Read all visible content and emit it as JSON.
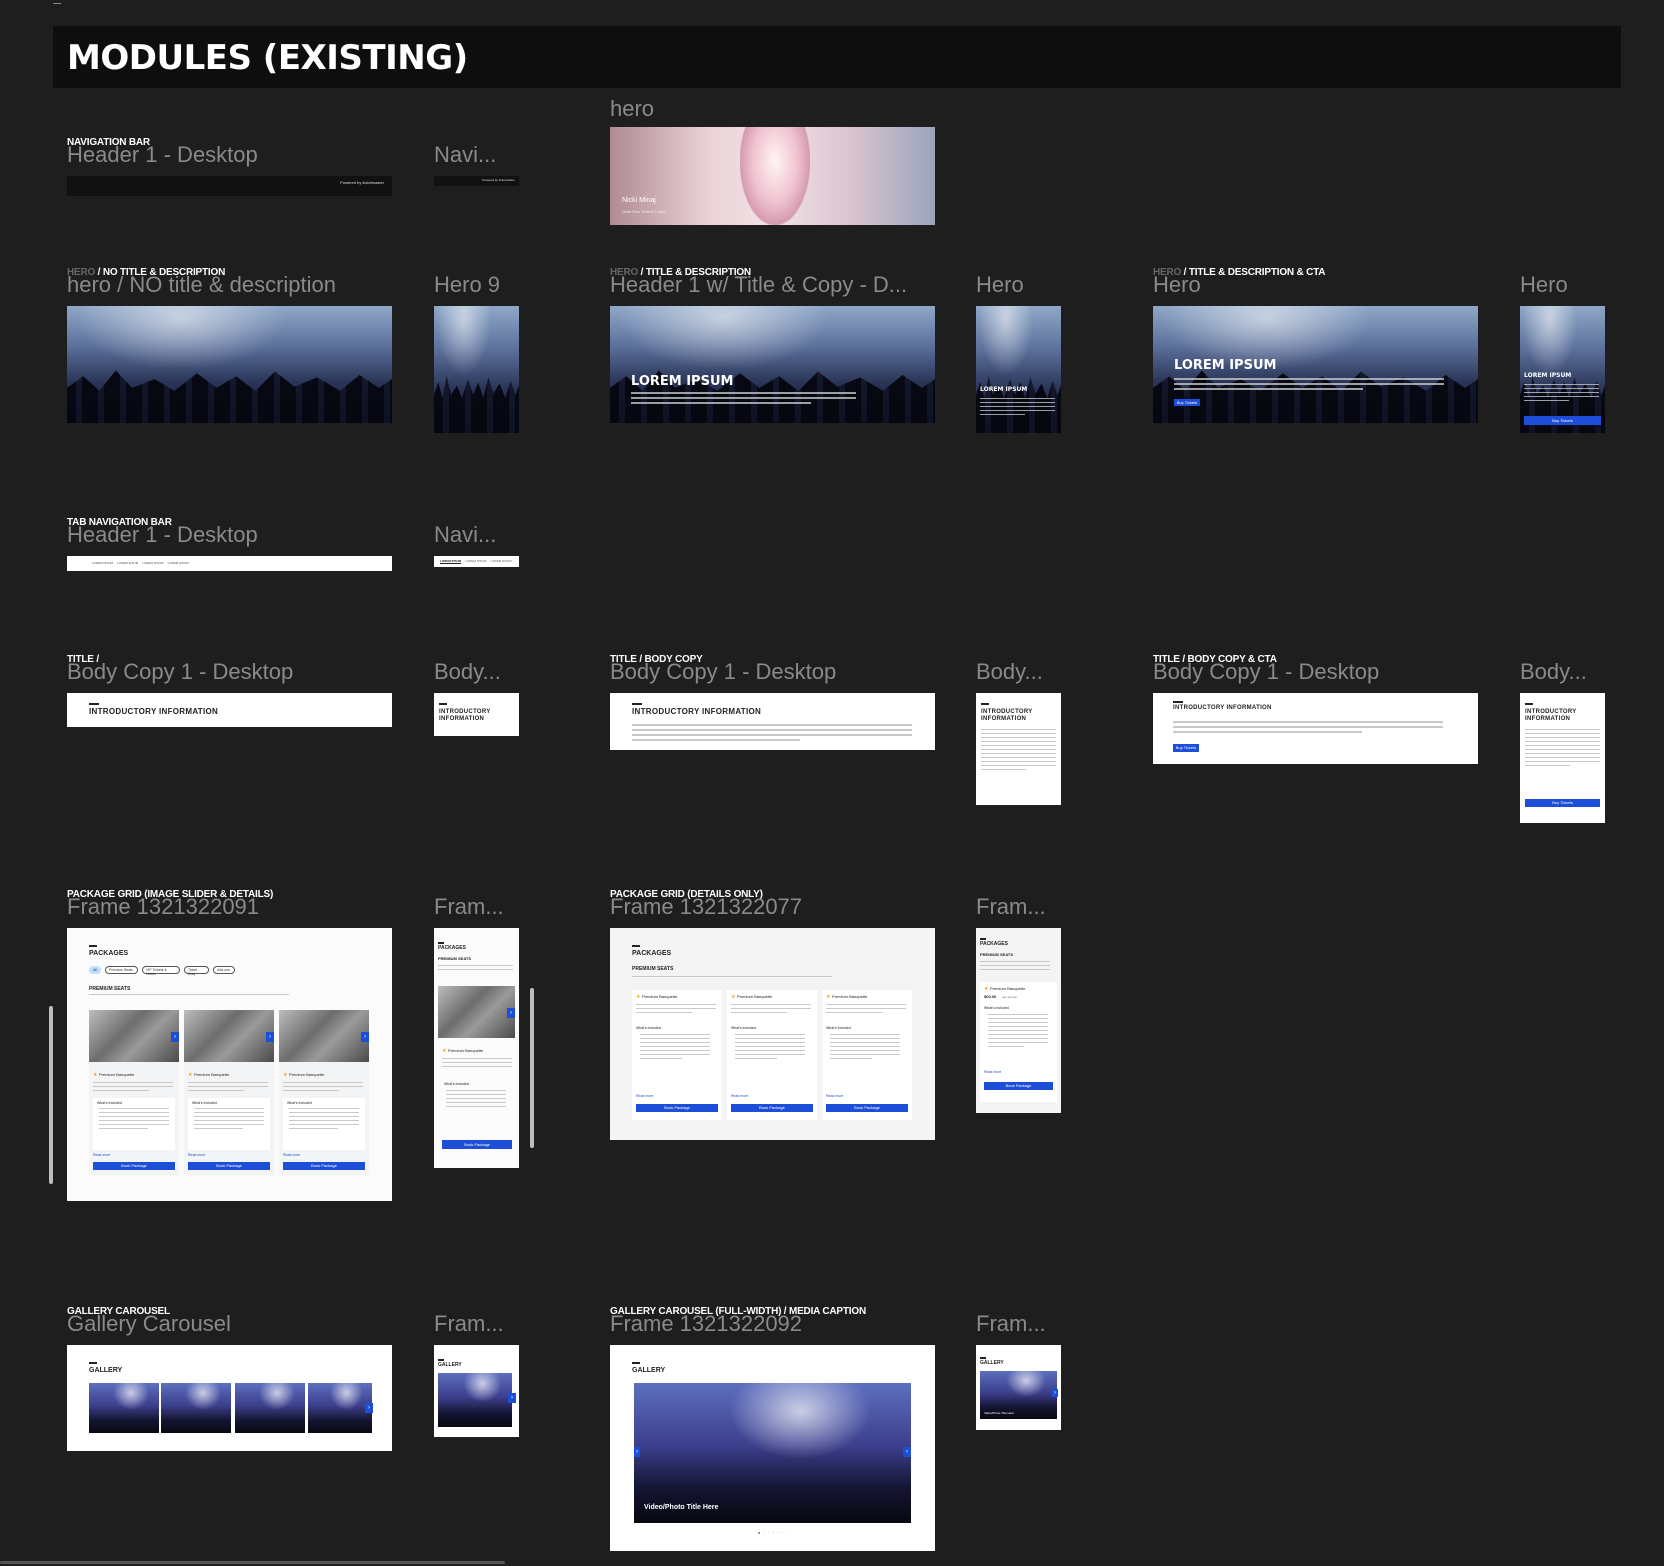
{
  "page_title": "MODULES (EXISTING)",
  "sections": {
    "navigation_bar": {
      "tag": "NAVIGATION BAR",
      "desktop_label": "Header 1 - Desktop",
      "mobile_label": "Navi...",
      "powered_by": "Powered by ticketmaster"
    },
    "hero_top": {
      "label": "hero",
      "artist": "Nicki Minaj",
      "artist_sub": "Grab Your Tickets Today"
    },
    "hero_no_title": {
      "tag_dim": "HERO",
      "tag": " / NO TITLE & DESCRIPTION",
      "desktop_label": "hero / NO title & description",
      "mobile_label": "Hero 9"
    },
    "hero_title_desc": {
      "tag_dim": "HERO",
      "tag": " / TITLE & DESCRIPTION",
      "desktop_label": "Header 1 w/ Title & Copy - D...",
      "mobile_label": "Hero",
      "title": "LOREM IPSUM"
    },
    "hero_title_desc_cta": {
      "tag_dim": "HERO",
      "tag": " / TITLE & DESCRIPTION & CTA",
      "desktop_label": "Hero",
      "mobile_label": "Hero",
      "title": "LOREM IPSUM",
      "cta": "Buy Tickets"
    },
    "tab_navigation_bar": {
      "tag": "TAB NAVIGATION BAR",
      "desktop_label": "Header 1 - Desktop",
      "mobile_label": "Navi...",
      "tab": "LOREM IPSUM"
    },
    "title_only": {
      "tag": "TITLE /",
      "desktop_label": "Body Copy 1 - Desktop",
      "mobile_label": "Body...",
      "heading": "INTRODUCTORY INFORMATION",
      "heading_m1": "INTRODUCTORY",
      "heading_m2": "INFORMATION"
    },
    "title_body": {
      "tag": "TITLE / BODY COPY",
      "desktop_label": "Body Copy 1 - Desktop",
      "mobile_label": "Body...",
      "heading": "INTRODUCTORY INFORMATION",
      "heading_m1": "INTRODUCTORY",
      "heading_m2": "INFORMATION"
    },
    "title_body_cta": {
      "tag": "TITLE / BODY COPY & CTA",
      "desktop_label": "Body Copy 1 - Desktop",
      "mobile_label": "Body...",
      "heading": "INTRODUCTORY INFORMATION",
      "heading_m1": "INTRODUCTORY",
      "heading_m2": "INFORMATION",
      "cta": "Buy Tickets"
    },
    "package_slider": {
      "tag": "PACKAGE GRID (IMAGE SLIDER & DETAILS)",
      "desktop_label": "Frame 1321322091",
      "mobile_label": "Fram...",
      "heading": "PACKAGES",
      "sub": "PREMIUM SEATS",
      "chips": [
        "All",
        "Premium Seats",
        "VIP Tickets & Hotels",
        "Ticket Only",
        "Add-ons"
      ],
      "card_title": "Premium Banquette",
      "included": "What's Included",
      "read_more": "Read more",
      "button": "Book Package"
    },
    "package_details": {
      "tag": "PACKAGE GRID (DETAILS ONLY)",
      "desktop_label": "Frame 1321322077",
      "mobile_label": "Fram...",
      "heading": "PACKAGES",
      "sub": "PREMIUM SEATS",
      "card_title": "Premium Banquette",
      "price": "$00.00",
      "price_unit": "/per person",
      "included": "What's Included",
      "read_more": "Read more",
      "button": "Book Package"
    },
    "gallery_carousel": {
      "tag": "GALLERY CAROUSEL",
      "desktop_label": "Gallery Carousel",
      "mobile_label": "Fram...",
      "heading": "GALLERY"
    },
    "gallery_full": {
      "tag": "GALLERY CAROUSEL (FULL-WIDTH) / MEDIA CAPTION",
      "desktop_label": "Frame 1321322092",
      "mobile_label": "Fram...",
      "heading": "GALLERY",
      "caption": "Video/Photo Title Here",
      "caption_small": "Video/Photo Title Here"
    }
  },
  "colors": {
    "canvas": "#1e1e1e",
    "accent_blue": "#1d4ed8",
    "label_gray": "#8a8a8a"
  }
}
